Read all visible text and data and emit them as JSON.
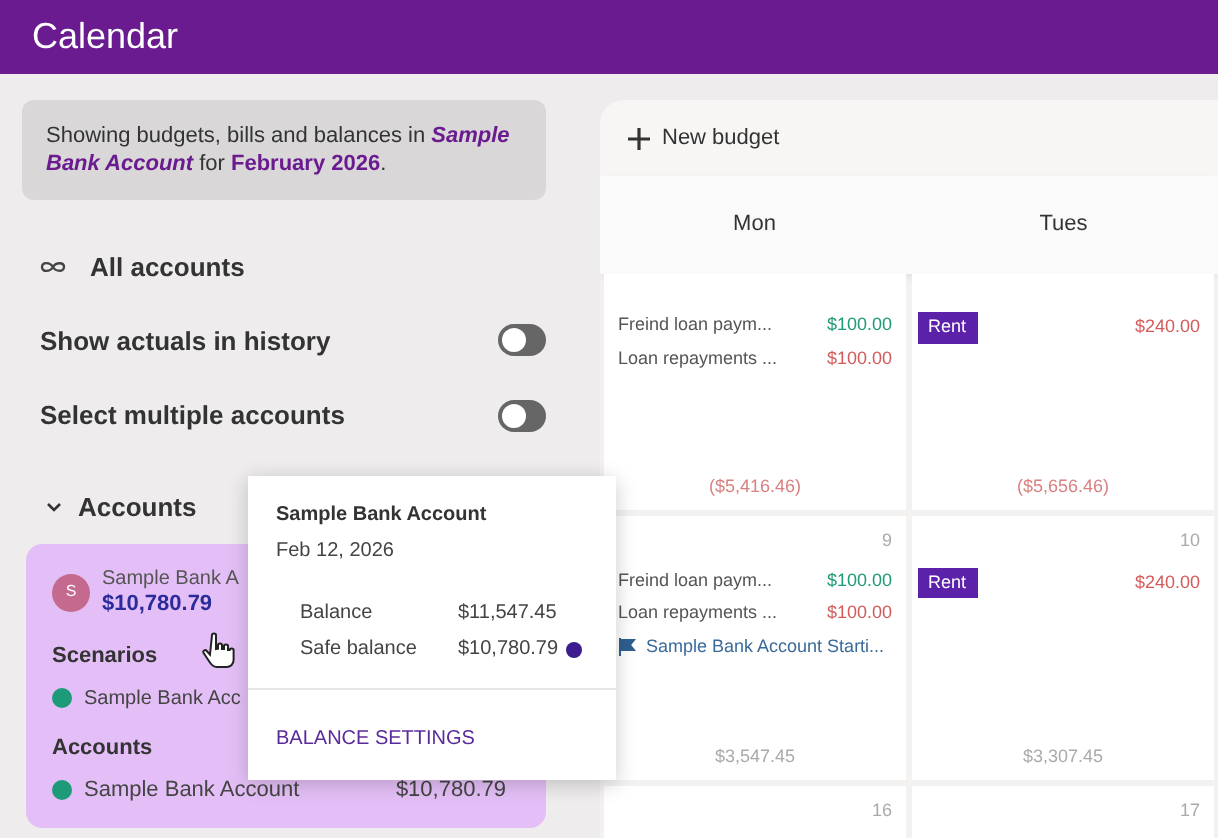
{
  "header": {
    "title": "Calendar"
  },
  "sidebar": {
    "notice": "Showing budgets, bills and balances in *Sample Bank Account* for **February 2026**.",
    "all_accounts": "All accounts",
    "toggles": [
      {
        "label": "Show actuals in history",
        "on": false
      },
      {
        "label": "Select multiple accounts",
        "on": false
      }
    ],
    "accounts_section": {
      "label": "Accounts",
      "expanded": true
    },
    "account_card": {
      "avatar": "S",
      "name": "Sample Bank A",
      "balance": "$10,780.79",
      "scenarios_heading": "Scenarios",
      "scenarios": [
        {
          "name": "Sample Bank Acc",
          "color": "#1d9a78"
        }
      ],
      "accounts_heading": "Accounts",
      "accounts": [
        {
          "name": "Sample Bank Account",
          "amount": "$10,780.79",
          "color": "#1d9a78"
        }
      ]
    }
  },
  "tooltip": {
    "title": "Sample Bank Account",
    "date": "Feb 12, 2026",
    "rows": [
      {
        "label": "Balance",
        "value": "$11,547.45",
        "info": false
      },
      {
        "label": "Safe balance",
        "value": "$10,780.79",
        "info": true
      }
    ],
    "action": "BALANCE SETTINGS"
  },
  "calendar": {
    "new_budget": "New budget",
    "days": [
      "Mon",
      "Tues"
    ],
    "weeks": [
      {
        "cells": [
          {
            "entries": [
              {
                "kind": "line",
                "label": "Freind loan paym...",
                "amount": "$100.00",
                "color": "#1d9a78"
              },
              {
                "kind": "line",
                "label": "Loan repayments ...",
                "amount": "$100.00",
                "color": "#d45a5a"
              }
            ],
            "balance": "($5,416.46)",
            "negative": true
          },
          {
            "entries": [
              {
                "kind": "tag",
                "label": "Rent",
                "amount": "$240.00",
                "color": "#d45a5a"
              }
            ],
            "balance": "($5,656.46)",
            "negative": true
          }
        ]
      },
      {
        "cells": [
          {
            "date": "9",
            "entries": [
              {
                "kind": "line",
                "label": "Freind loan paym...",
                "amount": "$100.00",
                "color": "#1d9a78"
              },
              {
                "kind": "line",
                "label": "Loan repayments ...",
                "amount": "$100.00",
                "color": "#d45a5a"
              },
              {
                "kind": "flag",
                "label": "Sample Bank Account Starti..."
              }
            ],
            "balance": "$3,547.45",
            "negative": false
          },
          {
            "date": "10",
            "entries": [
              {
                "kind": "tag",
                "label": "Rent",
                "amount": "$240.00",
                "color": "#d45a5a"
              }
            ],
            "balance": "$3,307.45",
            "negative": false
          }
        ]
      },
      {
        "cells": [
          {
            "date": "16"
          },
          {
            "date": "17"
          }
        ]
      }
    ]
  }
}
